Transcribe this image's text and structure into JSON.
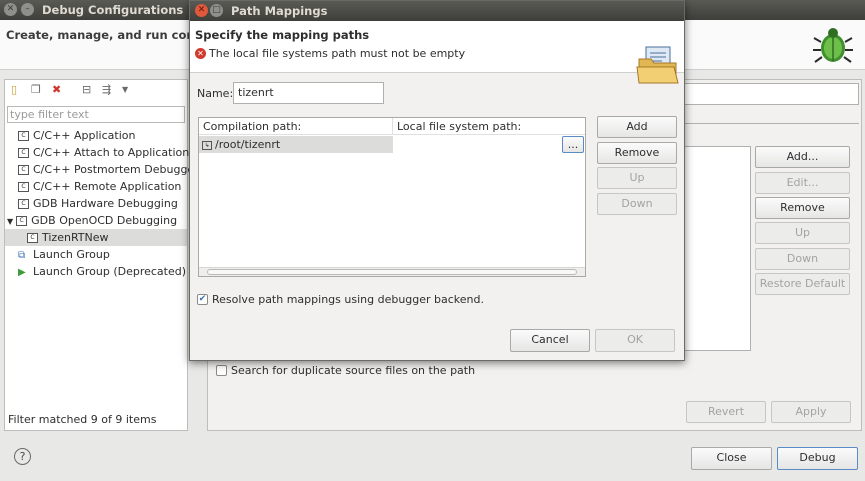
{
  "window": {
    "title": "Debug Configurations",
    "banner_text": "Create, manage, and run configu"
  },
  "left_panel": {
    "filter_placeholder": "type filter text",
    "tree": [
      {
        "label": "C/C++ Application",
        "icon": "c-config-icon",
        "indent": 0
      },
      {
        "label": "C/C++ Attach to Application",
        "icon": "c-config-icon",
        "indent": 0
      },
      {
        "label": "C/C++ Postmortem Debugger",
        "icon": "c-config-icon",
        "indent": 0
      },
      {
        "label": "C/C++ Remote Application",
        "icon": "c-config-icon",
        "indent": 0
      },
      {
        "label": "GDB Hardware Debugging",
        "icon": "c-config-icon",
        "indent": 0
      },
      {
        "label": "GDB OpenOCD Debugging",
        "icon": "c-config-icon",
        "indent": 0,
        "expanded": true
      },
      {
        "label": "TizenRTNew",
        "icon": "c-config-icon",
        "indent": 1,
        "selected": true
      },
      {
        "label": "Launch Group",
        "icon": "launch-group-icon",
        "indent": 0
      },
      {
        "label": "Launch Group (Deprecated)",
        "icon": "play-icon",
        "indent": 0
      }
    ],
    "filter_status": "Filter matched 9 of 9 items"
  },
  "right_panel": {
    "buttons": {
      "add": "Add...",
      "edit": "Edit...",
      "remove": "Remove",
      "up": "Up",
      "down": "Down",
      "restore_default": "Restore Default"
    },
    "search_duplicates_label": "Search for duplicate source files on the path",
    "revert": "Revert",
    "apply": "Apply"
  },
  "bottom": {
    "close": "Close",
    "debug": "Debug"
  },
  "dialog": {
    "title": "Path Mappings",
    "header_title": "Specify the mapping paths",
    "error_message": "The local file systems path must not be empty",
    "name_label": "Name:",
    "name_value": "tizenrt",
    "columns": [
      "Compilation path:",
      "Local file system path:"
    ],
    "rows": [
      {
        "compilation_path": "/root/tizenrt",
        "local_path": ""
      }
    ],
    "browse_label": "...",
    "buttons": {
      "add": "Add",
      "remove": "Remove",
      "up": "Up",
      "down": "Down",
      "cancel": "Cancel",
      "ok": "OK"
    },
    "resolve_label": "Resolve path mappings using debugger backend.",
    "resolve_checked": true
  }
}
